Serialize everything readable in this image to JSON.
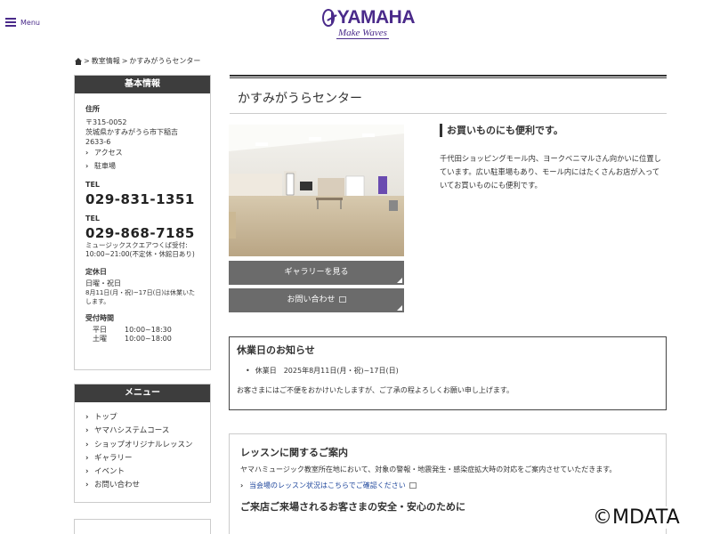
{
  "header": {
    "menu_label": "Menu",
    "logo_text": "YAMAHA",
    "logo_tagline": "Make Waves"
  },
  "breadcrumb": {
    "items": [
      "教室情報",
      "かすみがうらセンター"
    ],
    "separator": ">"
  },
  "sidebar": {
    "info_title": "基本情報",
    "address_label": "住所",
    "address_lines": [
      "〒315-0052",
      "茨城県かすみがうら市下稲吉",
      "2633-6"
    ],
    "links": [
      "アクセス",
      "駐車場"
    ],
    "tel1_label": "TEL",
    "tel1": "029-831-1351",
    "tel2_label": "TEL",
    "tel2": "029-868-7185",
    "tel2_note": "ミュージックスクエアつくば受付: 10:00~21:00(不定休・休館日あり)",
    "closed_label": "定休日",
    "closed_days": "日曜・祝日",
    "closed_note": "8月11日(月・祝)~17日(日)は休業いたします。",
    "hours_label": "受付時間",
    "hours": [
      {
        "day": "平日",
        "time": "10:00~18:30"
      },
      {
        "day": "土曜",
        "time": "10:00~18:00"
      }
    ],
    "menu_title": "メニュー",
    "menu_items": [
      "トップ",
      "ヤマハシステムコース",
      "ショップオリジナルレッスン",
      "ギャラリー",
      "イベント",
      "お問い合わせ"
    ]
  },
  "main": {
    "title": "かすみがうらセンター",
    "gallery_button": "ギャラリーを見る",
    "contact_button": "お問い合わせ",
    "feature_heading": "お買いものにも便利です。",
    "feature_text": "千代田ショッピングモール内、ヨークベニマルさん向かいに位置しています。広い駐車場もあり、モール内にはたくさんお店が入っていてお買いものにも便利です。",
    "closure_title": "休業日のお知らせ",
    "closure_item": "休業日　2025年8月11日(月・祝)~17日(日)",
    "closure_text": "お客さまにはご不便をおかけいたしますが、ご了承の程よろしくお願い申し上げます。",
    "lesson_title": "レッスンに関するご案内",
    "lesson_text": "ヤマハミュージック教室所在地において、対象の警報・地震発生・感染症拡大時の対応をご案内させていただきます。",
    "lesson_link": "当会場のレッスン状況はこちらでご確認ください",
    "safety_title": "ご来店ご来場されるお客さまの安全・安心のために"
  },
  "watermark": "©MDATA",
  "colors": {
    "brand": "#4a2a8a",
    "sidebar_head": "#3d3d3d",
    "button": "#6b6b6b",
    "link": "#234a9e"
  }
}
